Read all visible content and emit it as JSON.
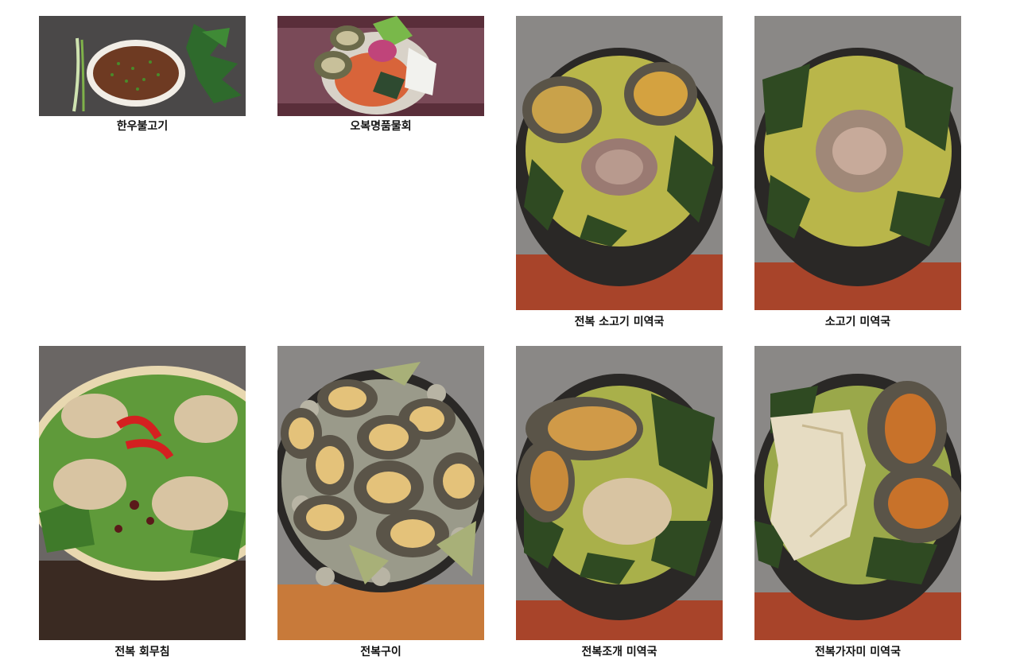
{
  "gallery": {
    "items": [
      {
        "name": "한우불고기",
        "image_icon": "beef-bulgogi-photo"
      },
      {
        "name": "오복명품물회",
        "image_icon": "mulhoe-photo"
      },
      {
        "name": "전복 소고기 미역국",
        "image_icon": "abalone-beef-seaweed-soup-photo"
      },
      {
        "name": "소고기 미역국",
        "image_icon": "beef-seaweed-soup-photo"
      },
      {
        "name": "전복 회무침",
        "image_icon": "abalone-salad-photo"
      },
      {
        "name": "전복구이",
        "image_icon": "grilled-abalone-photo"
      },
      {
        "name": "전복조개 미역국",
        "image_icon": "abalone-clam-seaweed-soup-photo"
      },
      {
        "name": "전복가자미 미역국",
        "image_icon": "abalone-flounder-seaweed-soup-photo"
      }
    ]
  },
  "colors": {
    "caption_text": "#111111",
    "background": "#ffffff"
  }
}
